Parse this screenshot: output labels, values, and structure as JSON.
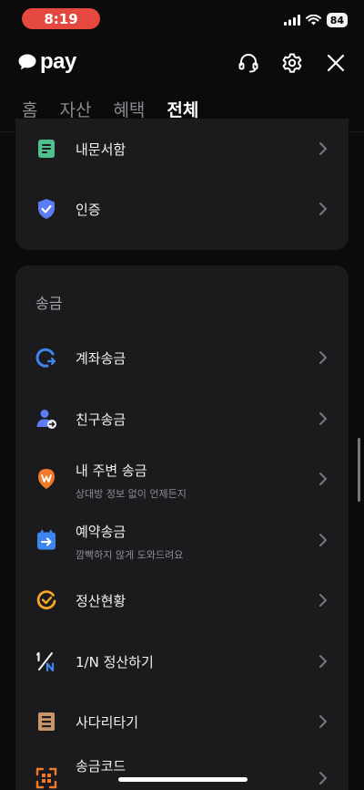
{
  "status_bar": {
    "time": "8:19",
    "battery": "84"
  },
  "header": {
    "logo_text": "pay"
  },
  "tabs": [
    {
      "label": "홈"
    },
    {
      "label": "자산"
    },
    {
      "label": "혜택"
    },
    {
      "label": "전체"
    }
  ],
  "top_card": {
    "items": [
      {
        "label": "내문서함"
      },
      {
        "label": "인증"
      }
    ]
  },
  "send_card": {
    "title": "송금",
    "items": [
      {
        "label": "계좌송금",
        "sub": ""
      },
      {
        "label": "친구송금",
        "sub": ""
      },
      {
        "label": "내 주변 송금",
        "sub": "상대방 정보 없이 언제든지"
      },
      {
        "label": "예약송금",
        "sub": "깜빡하지 않게 도와드려요"
      },
      {
        "label": "정산현황",
        "sub": ""
      },
      {
        "label": "1/N 정산하기",
        "sub": ""
      },
      {
        "label": "사다리타기",
        "sub": ""
      },
      {
        "label": "송금코드",
        "sub": ""
      }
    ]
  },
  "colors": {
    "background": "#0b0b0c",
    "card": "#1b1b1e",
    "time_pill": "#e5483f",
    "blue": "#3d86f0",
    "orange": "#f07a2a",
    "green": "#4fc08d"
  }
}
